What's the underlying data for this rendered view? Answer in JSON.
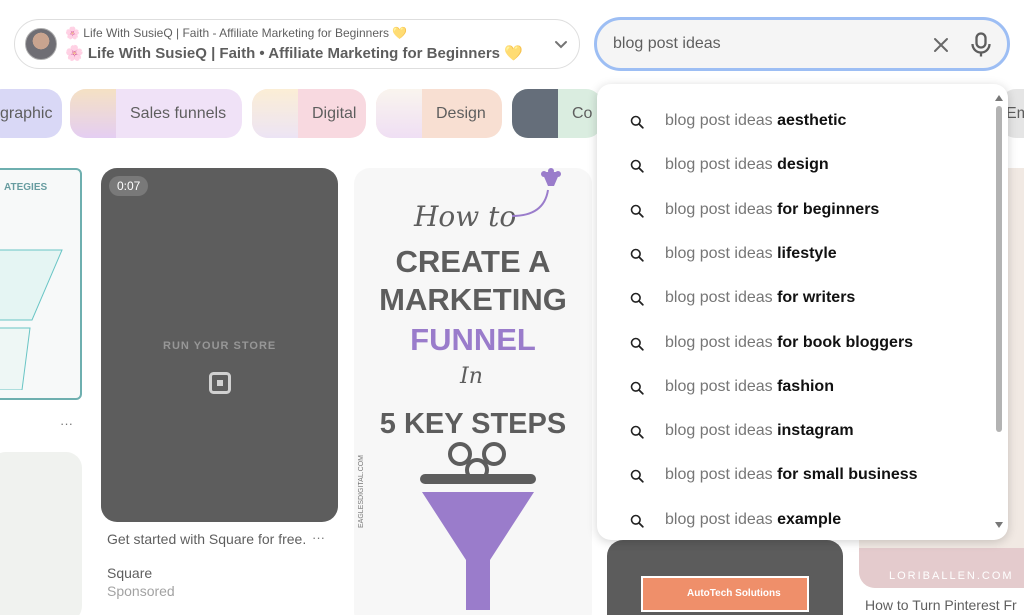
{
  "board": {
    "line1": "Life With SusieQ | Faith - Affiliate Marketing for Beginners",
    "line2": "Life With SusieQ | Faith • Affiliate Marketing for Beginners",
    "flower_emoji": "🌸",
    "heart_emoji": "💛"
  },
  "search": {
    "query": "blog post ideas",
    "clear_icon": "close-icon",
    "mic_icon": "microphone-icon"
  },
  "chips": [
    {
      "label": "graphic"
    },
    {
      "label": "Sales funnels"
    },
    {
      "label": "Digital"
    },
    {
      "label": "Design"
    },
    {
      "label": "Co"
    },
    {
      "label": "Em"
    }
  ],
  "pins": {
    "video_duration": "0:07",
    "video_overlay_text": "RUN YOUR STORE",
    "square_title": "Get started with Square for free.",
    "square_brand": "Square",
    "square_sponsored": "Sponsored",
    "more_label": "···",
    "funnel_how_to": "How to",
    "funnel_line1": "CREATE A",
    "funnel_line2": "MARKETING",
    "funnel_line3": "FUNNEL",
    "funnel_in": "In",
    "funnel_line4": "5 KEY STEPS",
    "funnel_site": "EAGLESDIGITAL.COM",
    "strategies_title": "ATEGIES",
    "autotech": "AutoTech Solutions",
    "loriballen": "LORIBALLEN.COM",
    "turn_pinterest": "How to Turn Pinterest Fr"
  },
  "suggestions": [
    {
      "base": "blog post ideas ",
      "completion": "aesthetic"
    },
    {
      "base": "blog post ideas ",
      "completion": "design"
    },
    {
      "base": "blog post ideas ",
      "completion": "for beginners"
    },
    {
      "base": "blog post ideas ",
      "completion": "lifestyle"
    },
    {
      "base": "blog post ideas ",
      "completion": "for writers"
    },
    {
      "base": "blog post ideas ",
      "completion": "for book bloggers"
    },
    {
      "base": "blog post ideas ",
      "completion": "fashion"
    },
    {
      "base": "blog post ideas ",
      "completion": "instagram"
    },
    {
      "base": "blog post ideas ",
      "completion": "for small business"
    },
    {
      "base": "blog post ideas ",
      "completion": "example"
    }
  ],
  "colors": {
    "search_focus": "#6fa0ef",
    "chip_purple": "#c7c6f2",
    "chip_pink": "#f5c8d2",
    "chip_peach": "#f5d0bd",
    "funnel_purple": "#6a3fb3"
  }
}
